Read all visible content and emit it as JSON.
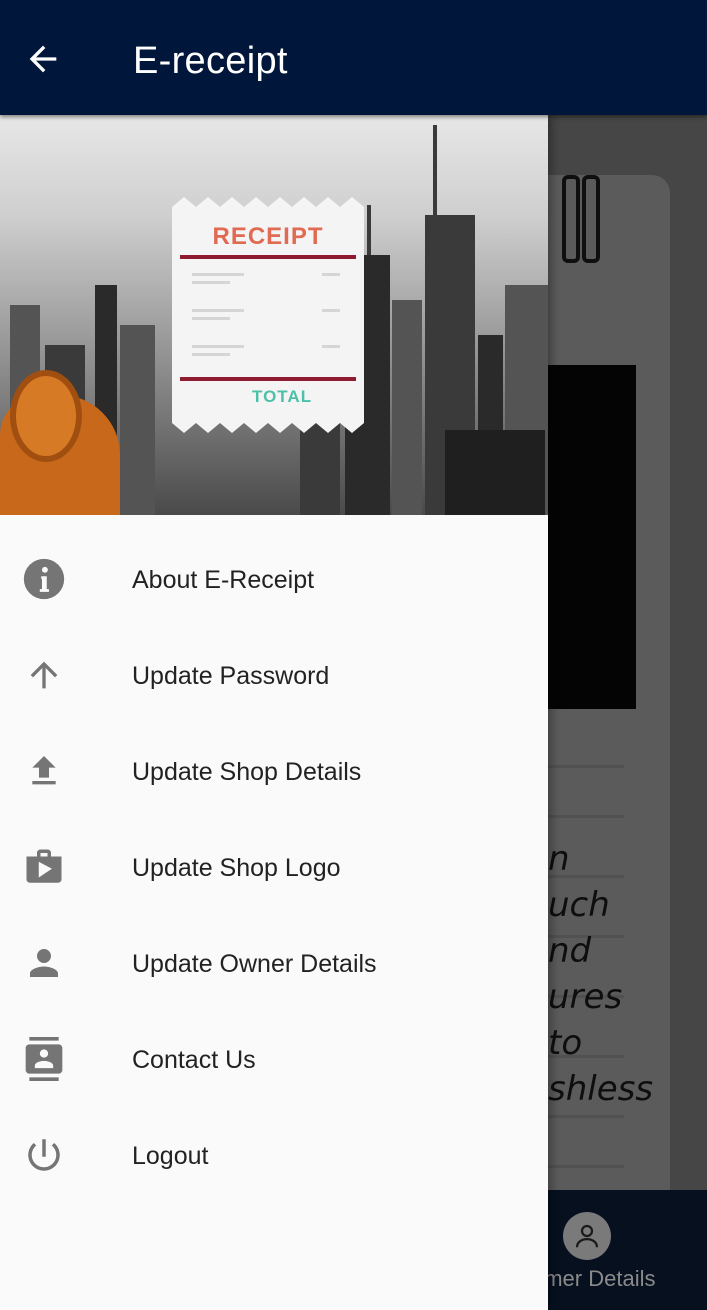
{
  "app_bar": {
    "title": "E-receipt",
    "back_icon": "arrow-back-icon",
    "background": "#00163a"
  },
  "drawer": {
    "header": {
      "receipt_title": "RECEIPT",
      "receipt_total": "TOTAL"
    },
    "items": [
      {
        "label": "About E-Receipt",
        "icon": "info-icon"
      },
      {
        "label": "Update Password",
        "icon": "arrow-up-icon"
      },
      {
        "label": "Update Shop Details",
        "icon": "upload-icon"
      },
      {
        "label": "Update Shop Logo",
        "icon": "shop-play-icon"
      },
      {
        "label": "Update Owner Details",
        "icon": "person-icon"
      },
      {
        "label": "Contact Us",
        "icon": "contact-card-icon"
      },
      {
        "label": "Logout",
        "icon": "power-icon"
      }
    ],
    "icon_color": "#757575",
    "text_color": "#222222"
  },
  "background_page": {
    "partial_text_lines": [
      "n",
      "uch",
      "nd",
      "ures",
      "to",
      "shless"
    ],
    "bottom_nav_label": "omer Details"
  }
}
